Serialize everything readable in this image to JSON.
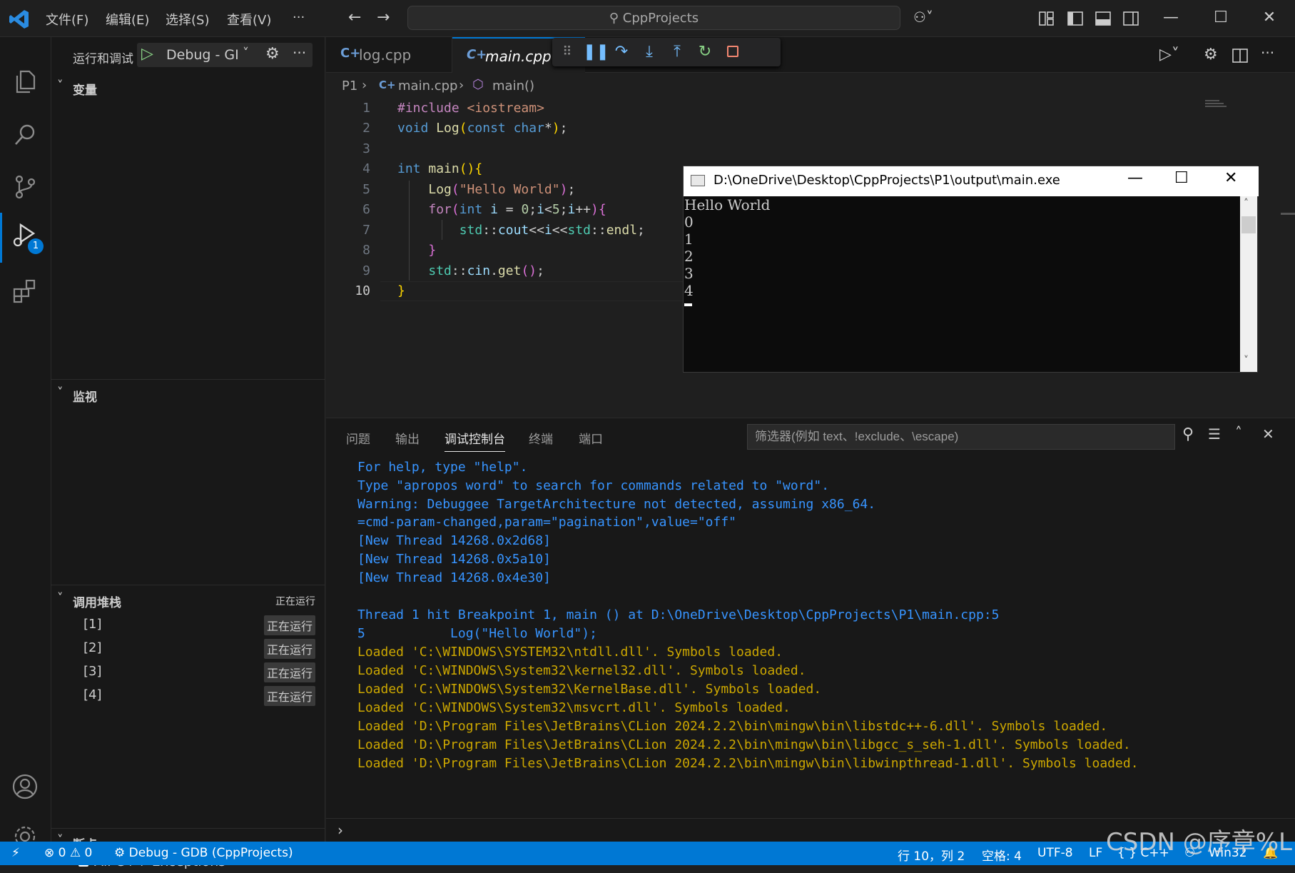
{
  "titlebar": {
    "menu": [
      "文件(F)",
      "编辑(E)",
      "选择(S)",
      "查看(V)"
    ],
    "more": "···",
    "search": "CppProjects"
  },
  "activity": {
    "debug_badge": "1"
  },
  "sidebar": {
    "run_label": "运行和调试",
    "config": "Debug - GI",
    "sections": {
      "variables": "变量",
      "watch": "监视",
      "callstack": "调用堆栈",
      "callstack_status": "正在运行",
      "breakpoints": "断点"
    },
    "threads": [
      {
        "name": "[1]",
        "state": "正在运行"
      },
      {
        "name": "[2]",
        "state": "正在运行"
      },
      {
        "name": "[3]",
        "state": "正在运行"
      },
      {
        "name": "[4]",
        "state": "正在运行"
      }
    ],
    "breakpoint_item": "All C++ Exceptions"
  },
  "tabs": [
    {
      "label": "log.cpp",
      "active": false
    },
    {
      "label": "main.cpp",
      "active": true
    }
  ],
  "breadcrumbs": {
    "folder": "P1",
    "file": "main.cpp",
    "symbol": "main()"
  },
  "editor": {
    "line_numbers": [
      "1",
      "2",
      "3",
      "4",
      "5",
      "6",
      "7",
      "8",
      "9",
      "10"
    ],
    "current_line": "10"
  },
  "console_window": {
    "title": "D:\\OneDrive\\Desktop\\CppProjects\\P1\\output\\main.exe",
    "lines": [
      "Hello World",
      "0",
      "1",
      "2",
      "3",
      "4"
    ]
  },
  "panel": {
    "tabs": [
      "问题",
      "输出",
      "调试控制台",
      "终端",
      "端口"
    ],
    "active_tab": "调试控制台",
    "filter_placeholder": "筛选器(例如 text、!exclude、\\escape)",
    "lines": [
      {
        "text": "For help, type \"help\".",
        "color": "blue"
      },
      {
        "text": "Type \"apropos word\" to search for commands related to \"word\".",
        "color": "blue"
      },
      {
        "text": "Warning: Debuggee TargetArchitecture not detected, assuming x86_64.",
        "color": "blue"
      },
      {
        "text": "=cmd-param-changed,param=\"pagination\",value=\"off\"",
        "color": "blue"
      },
      {
        "text": "[New Thread 14268.0x2d68]",
        "color": "blue"
      },
      {
        "text": "[New Thread 14268.0x5a10]",
        "color": "blue"
      },
      {
        "text": "[New Thread 14268.0x4e30]",
        "color": "blue"
      },
      {
        "text": "",
        "color": "blue"
      },
      {
        "text": "Thread 1 hit Breakpoint 1, main () at D:\\OneDrive\\Desktop\\CppProjects\\P1\\main.cpp:5",
        "color": "blue"
      },
      {
        "text": "5           Log(\"Hello World\");",
        "color": "blue"
      },
      {
        "text": "Loaded 'C:\\WINDOWS\\SYSTEM32\\ntdll.dll'. Symbols loaded.",
        "color": "yellow"
      },
      {
        "text": "Loaded 'C:\\WINDOWS\\System32\\kernel32.dll'. Symbols loaded.",
        "color": "yellow"
      },
      {
        "text": "Loaded 'C:\\WINDOWS\\System32\\KernelBase.dll'. Symbols loaded.",
        "color": "yellow"
      },
      {
        "text": "Loaded 'C:\\WINDOWS\\System32\\msvcrt.dll'. Symbols loaded.",
        "color": "yellow"
      },
      {
        "text": "Loaded 'D:\\Program Files\\JetBrains\\CLion 2024.2.2\\bin\\mingw\\bin\\libstdc++-6.dll'. Symbols loaded.",
        "color": "yellow"
      },
      {
        "text": "Loaded 'D:\\Program Files\\JetBrains\\CLion 2024.2.2\\bin\\mingw\\bin\\libgcc_s_seh-1.dll'. Symbols loaded.",
        "color": "yellow"
      },
      {
        "text": "Loaded 'D:\\Program Files\\JetBrains\\CLion 2024.2.2\\bin\\mingw\\bin\\libwinpthread-1.dll'. Symbols loaded.",
        "color": "yellow"
      }
    ]
  },
  "statusbar": {
    "errors": "0",
    "warnings": "0",
    "debug": "Debug - GDB (CppProjects)",
    "position": "行 10，列 2",
    "spaces": "空格: 4",
    "encoding": "UTF-8",
    "eol": "LF",
    "language": "C++",
    "platform": "Win32"
  },
  "watermark": "CSDN @序章%L",
  "colors": {
    "accent": "#0078d4",
    "console_blue": "#3794ff",
    "console_yellow": "#cca700"
  }
}
